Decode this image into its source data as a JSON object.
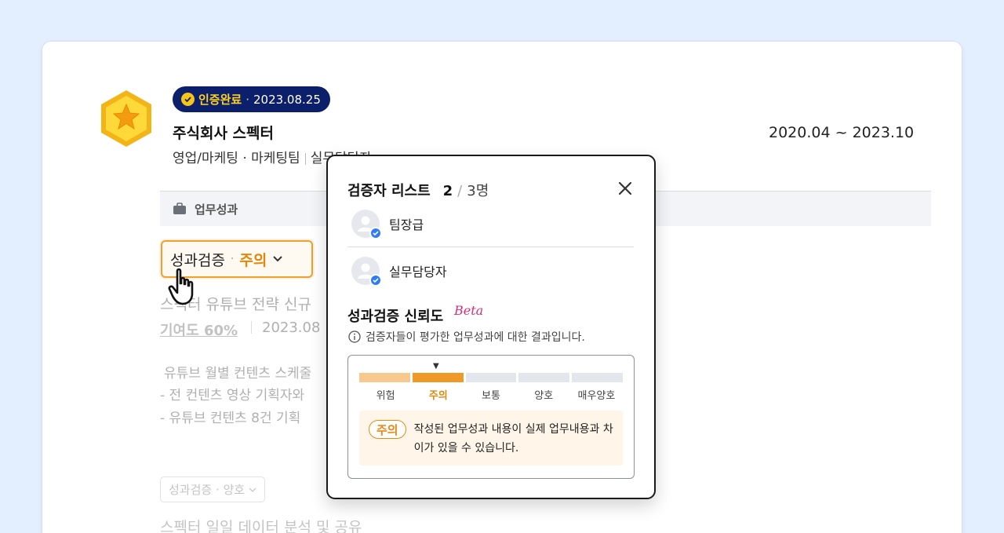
{
  "header": {
    "cert_label": "인증완료",
    "cert_separator": "·",
    "cert_date": "2023.08.25",
    "company": "주식회사 스펙터",
    "dept": "영업/마케팅 · 마케팅팀",
    "role_partial": "실무담당자",
    "period": "2020.04 ~ 2023.10"
  },
  "section": {
    "title": "업무성과"
  },
  "verify_chip": {
    "label": "성과검증",
    "separator": "·",
    "level": "주의"
  },
  "faded": {
    "title": "스펙터 유튜브 전략 신규",
    "contribution": "기여도 60%",
    "date": "2023.08",
    "lines": [
      "유튜브 월별 컨텐츠 스케줄",
      "- 전 컨텐츠 영상 기획자와",
      "- 유튜브 컨텐츠 8건 기획"
    ],
    "chip2": "성과검증 · 양호",
    "bottom": "스펙터 일일 데이터 분석 및 공유"
  },
  "popup": {
    "title": "검증자 리스트",
    "count": "2",
    "slash": "/",
    "total": "3명",
    "verifiers": [
      {
        "label": "팀장급"
      },
      {
        "label": "실무담당자"
      }
    ],
    "reliability_title": "성과검증 신뢰도",
    "beta": "Beta",
    "reliability_desc": "검증자들이 평가한 업무성과에 대한 결과입니다.",
    "scale": {
      "levels": [
        "위험",
        "주의",
        "보통",
        "양호",
        "매우양호"
      ],
      "active_index": 1,
      "colors": {
        "danger": "#f8c98f",
        "caution": "#ef9a28",
        "inactive": "#e3e6ec",
        "active_text": "#e0880d"
      }
    },
    "note_chip": "주의",
    "note_text": "작성된 업무성과 내용이 실제 업무내용과 차이가 있을 수 있습니다."
  }
}
